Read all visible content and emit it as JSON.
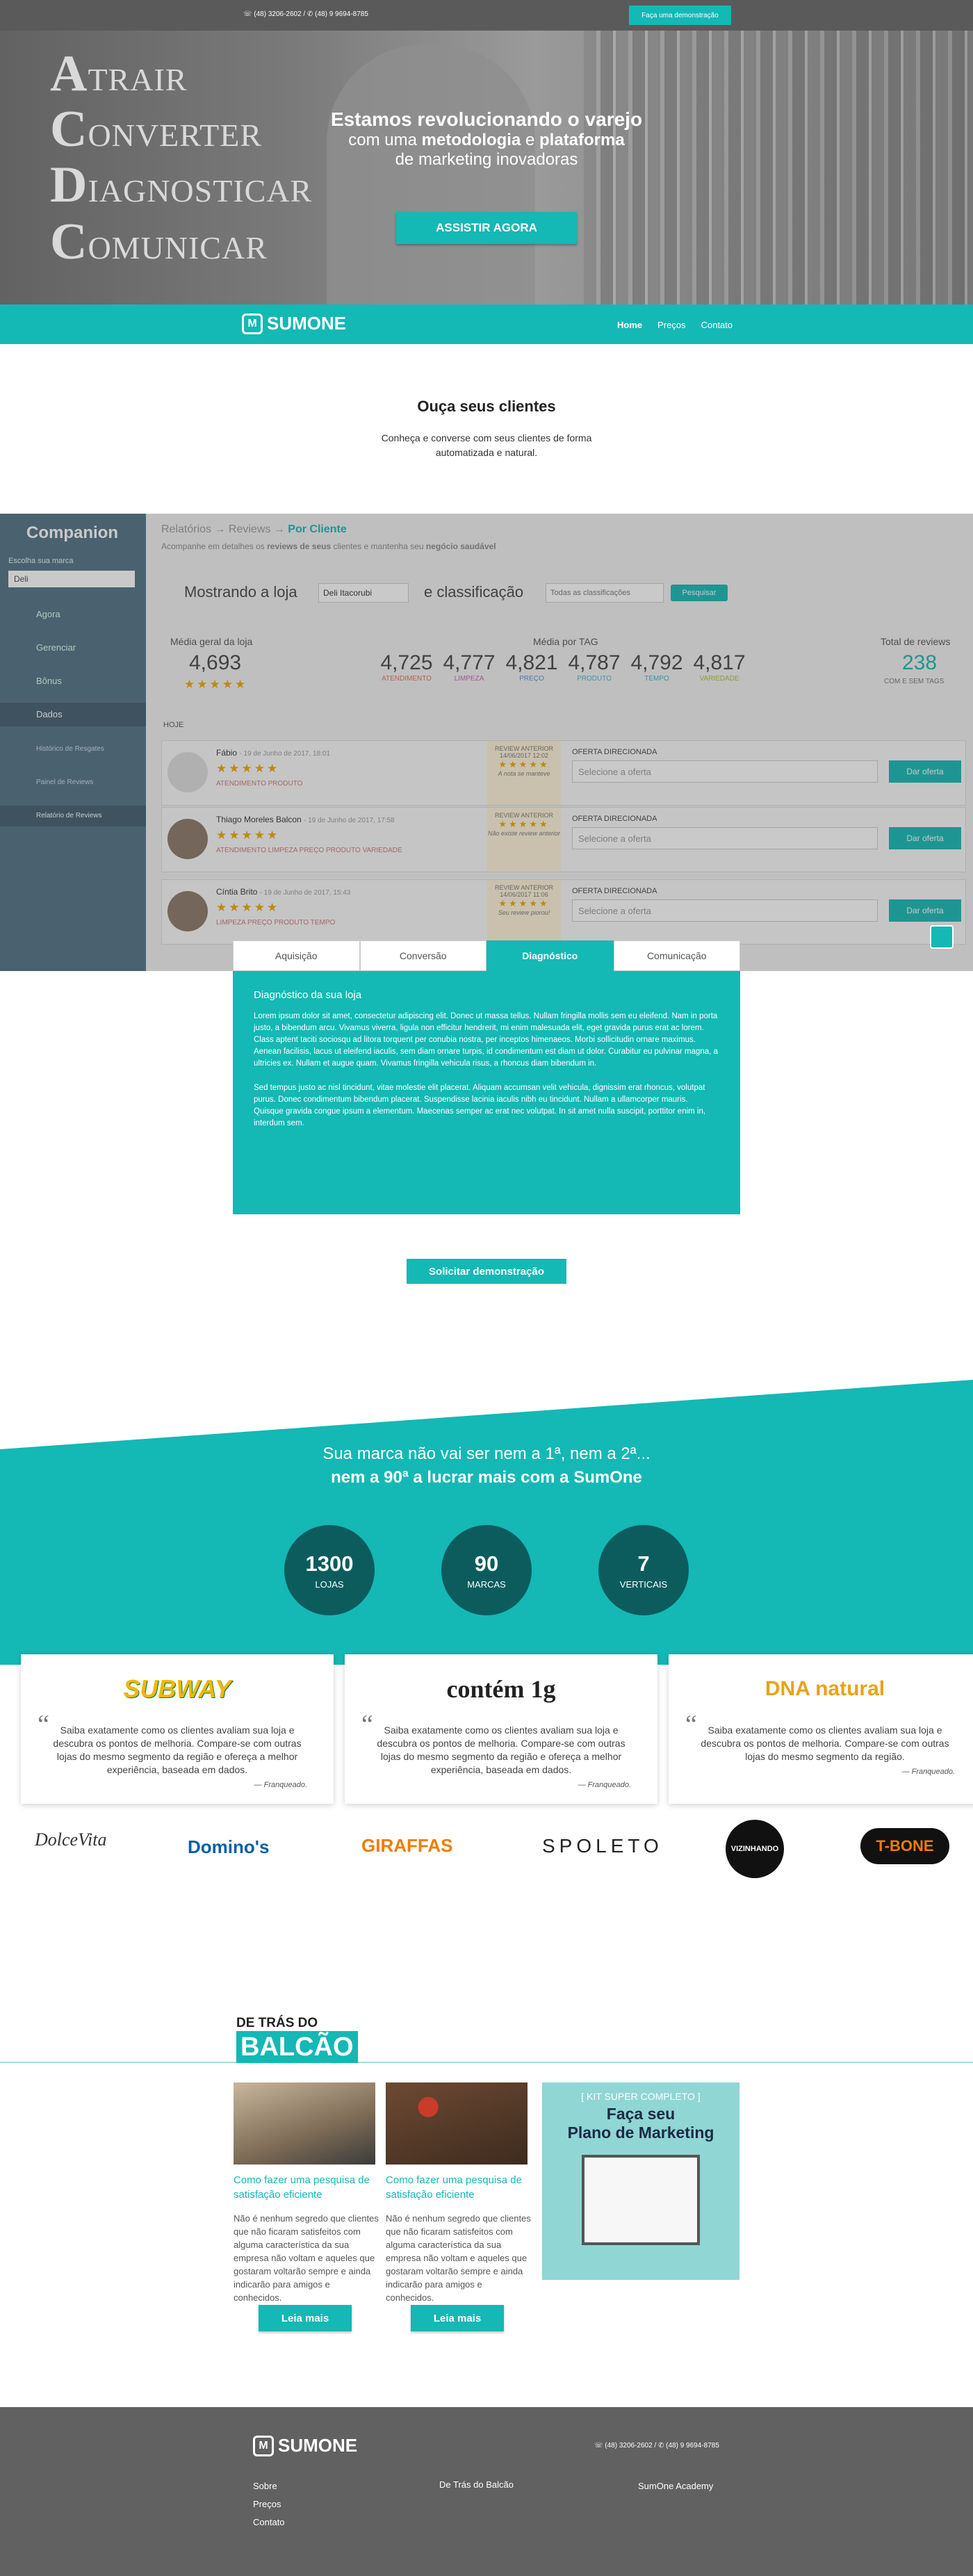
{
  "topbar": {
    "phones": "☏ (48) 3206-2602 / ✆ (48) 9 9694-8785",
    "demo_button": "Faça uma demonstração"
  },
  "hero": {
    "acdc": [
      {
        "initial": "A",
        "rest": "TRAIR"
      },
      {
        "initial": "C",
        "rest": "ONVERTER"
      },
      {
        "initial": "D",
        "rest": "IAGNOSTICAR"
      },
      {
        "initial": "C",
        "rest": "OMUNICAR"
      }
    ],
    "title": "Estamos revolucionando o varejo",
    "line2_a": "com uma ",
    "line2_b": "metodologia",
    "line2_c": " e ",
    "line2_d": "plataforma",
    "line3": "de marketing inovadoras",
    "cta": "ASSISTIR AGORA"
  },
  "nav": {
    "logo_mark": "M",
    "logo_text": "SUMONE",
    "items": [
      "Home",
      "Preços",
      "Contato"
    ]
  },
  "listen": {
    "title": "Ouça seus clientes",
    "subtitle_1": "Conheça e converse com seus clientes de forma",
    "subtitle_2": "automatizada e natural."
  },
  "dashboard": {
    "app": "Companion",
    "brand_label": "Escolha sua marca",
    "brand_value": "Deli",
    "menu": [
      "Agora",
      "Gerenciar",
      "Bônus",
      "Dados",
      "Histórico de Resgates",
      "Painel de Reviews",
      "Relatório de Reviews"
    ],
    "breadcrumb": [
      "Relatórios",
      "Reviews",
      "Por Cliente"
    ],
    "desc_1": "Acompanhe em detalhes os ",
    "desc_2": "reviews de seus",
    "desc_3": " clientes e mantenha seu ",
    "desc_4": "negócio saudável",
    "filter_label": "Mostrando a loja",
    "filter_store": "Deli Itacorubi",
    "filter_and": "e classificação",
    "filter_class": "Todas as classificações",
    "filter_btn": "Pesquisar",
    "avg_label": "Média geral da loja",
    "avg_value": "4,693",
    "tag_label": "Média por TAG",
    "tags": [
      {
        "value": "4,725",
        "name": "ATENDIMENTO",
        "color": "#e86b5b"
      },
      {
        "value": "4,777",
        "name": "LIMPEZA",
        "color": "#c95fb0"
      },
      {
        "value": "4,821",
        "name": "PREÇO",
        "color": "#5b8fd6"
      },
      {
        "value": "4,787",
        "name": "PRODUTO",
        "color": "#3fb7d8"
      },
      {
        "value": "4,792",
        "name": "TEMPO",
        "color": "#3bb0c9"
      },
      {
        "value": "4,817",
        "name": "VARIEDADE",
        "color": "#a4c63b"
      }
    ],
    "total_label": "Total de reviews",
    "total_value": "238",
    "total_sub": "COM E SEM TAGS",
    "today": "HOJE",
    "reviews": [
      {
        "name": "Fábio",
        "date": "- 19 de Junho de 2017, 18:01",
        "tags": "ATENDIMENTO  PRODUTO",
        "prev_label": "REVIEW ANTERIOR",
        "prev_date": "14/06/2017 12:02",
        "prev_note": "A nota se manteve",
        "offer_label": "OFERTA DIRECIONADA",
        "offer_placeholder": "Selecione a oferta",
        "offer_btn": "Dar oferta"
      },
      {
        "name": "Thiago Moreles Balcon",
        "date": "- 19 de Junho de 2017, 17:58",
        "tags": "ATENDIMENTO  LIMPEZA  PREÇO  PRODUTO  VARIEDADE",
        "prev_label": "REVIEW ANTERIOR",
        "prev_date": "",
        "prev_note": "Não existe review anterior",
        "offer_label": "OFERTA DIRECIONADA",
        "offer_placeholder": "Selecione a oferta",
        "offer_btn": "Dar oferta"
      },
      {
        "name": "Cíntia Brito",
        "date": "- 19 de Junho de 2017, 15:43",
        "tags": "LIMPEZA  PREÇO  PRODUTO  TEMPO",
        "prev_label": "REVIEW ANTERIOR",
        "prev_date": "14/06/2017 11:06",
        "prev_note": "Seu review piorou!",
        "offer_label": "OFERTA DIRECIONADA",
        "offer_placeholder": "Selecione a oferta",
        "offer_btn": "Dar oferta"
      }
    ]
  },
  "tabs": {
    "items": [
      "Aquisição",
      "Conversão",
      "Diagnóstico",
      "Comunicação"
    ],
    "active": 2,
    "panel_title": "Diagnóstico da sua loja",
    "p1": "Lorem ipsum dolor sit amet, consectetur adipiscing elit. Donec ut massa tellus. Nullam fringilla mollis sem eu eleifend. Nam in porta justo, a bibendum arcu. Vivamus viverra, ligula non efficitur hendrerit, mi enim malesuada elit, eget gravida purus erat ac lorem. Class aptent taciti sociosqu ad litora torquent per conubia nostra, per inceptos himenaeos. Morbi sollicitudin ornare maximus. Aenean facilisis, lacus ut eleifend iaculis, sem diam ornare turpis, id condimentum est diam ut dolor. Curabitur eu pulvinar magna, a ultricies ex. Nullam et augue quam. Vivamus fringilla vehicula risus, a rhoncus diam bibendum in.",
    "p2": "Sed tempus justo ac nisl tincidunt, vitae molestie elit placerat. Aliquam accumsan velit vehicula, dignissim erat rhoncus, volutpat purus. Donec condimentum bibendum placerat. Suspendisse lacinia iaculis nibh eu tincidunt. Nullam a ullamcorper mauris. Quisque gravida congue ipsum a elementum. Maecenas semper ac erat nec volutpat. In sit amet nulla suscipit, porttitor enim in, interdum sem."
  },
  "solicit": "Solicitar demonstração",
  "brand_section": {
    "line1": "Sua marca não vai ser nem a 1ª, nem a 2ª...",
    "line2": "nem a 90ª a lucrar mais com a SumOne",
    "stats": [
      {
        "number": "1300",
        "label": "LOJAS"
      },
      {
        "number": "90",
        "label": "MARCAS"
      },
      {
        "number": "7",
        "label": "VERTICAIS"
      }
    ]
  },
  "testimonials": [
    {
      "brand": "SUBWAY",
      "quote": "Saiba exatamente como os clientes avaliam sua loja e descubra os pontos de melhoria. Compare-se com outras lojas do mesmo segmento da região e ofereça a melhor experiência, baseada em dados.",
      "author": "— Franqueado."
    },
    {
      "brand": "contém 1g",
      "quote": "Saiba exatamente como os clientes avaliam sua loja e descubra os pontos de melhoria. Compare-se com outras lojas do mesmo segmento da região e ofereça a melhor experiência, baseada em dados.",
      "author": "— Franqueado."
    },
    {
      "brand": "DNA natural",
      "quote": "Saiba exatamente como os clientes avaliam sua loja e descubra os pontos de melhoria. Compare-se com outras lojas do mesmo segmento da região.",
      "author": "— Franqueado."
    }
  ],
  "brands": [
    "DolceVita",
    "Domino's",
    "GIRAFFAS",
    "SPOLETO",
    "VIZINHANDO",
    "T-BONE"
  ],
  "blog": {
    "heading_1": "DE TRÁS DO",
    "heading_2": "BALCÃO",
    "posts": [
      {
        "title": "Como fazer uma pesquisa de satisfação eficiente",
        "text": "Não é nenhum segredo que clientes que não ficaram satisfeitos com alguma característica da sua empresa não voltam e aqueles que gostaram voltarão sempre e ainda indicarão para amigos e conhecidos.",
        "button": "Leia mais"
      },
      {
        "title": "Como fazer uma pesquisa de satisfação eficiente",
        "text": "Não é nenhum segredo que clientes que não ficaram satisfeitos com alguma característica da sua empresa não voltam e aqueles que gostaram voltarão sempre e ainda indicarão para amigos e conhecidos.",
        "button": "Leia mais"
      }
    ],
    "kit_tag": "[ KIT SUPER COMPLETO ]",
    "kit_title_1": "Faça seu",
    "kit_title_2": "Plano de Marketing"
  },
  "footer": {
    "phones": "☏ (48) 3206-2602 / ✆ (48) 9 9694-8785",
    "links": [
      "Sobre",
      "Preços",
      "Contato"
    ],
    "blog": "De Trás do Balcão",
    "academy": "SumOne Academy"
  },
  "colors": {
    "accent": "#14b8b5",
    "dark_teal": "#0c5c5e",
    "footer": "#616161"
  }
}
